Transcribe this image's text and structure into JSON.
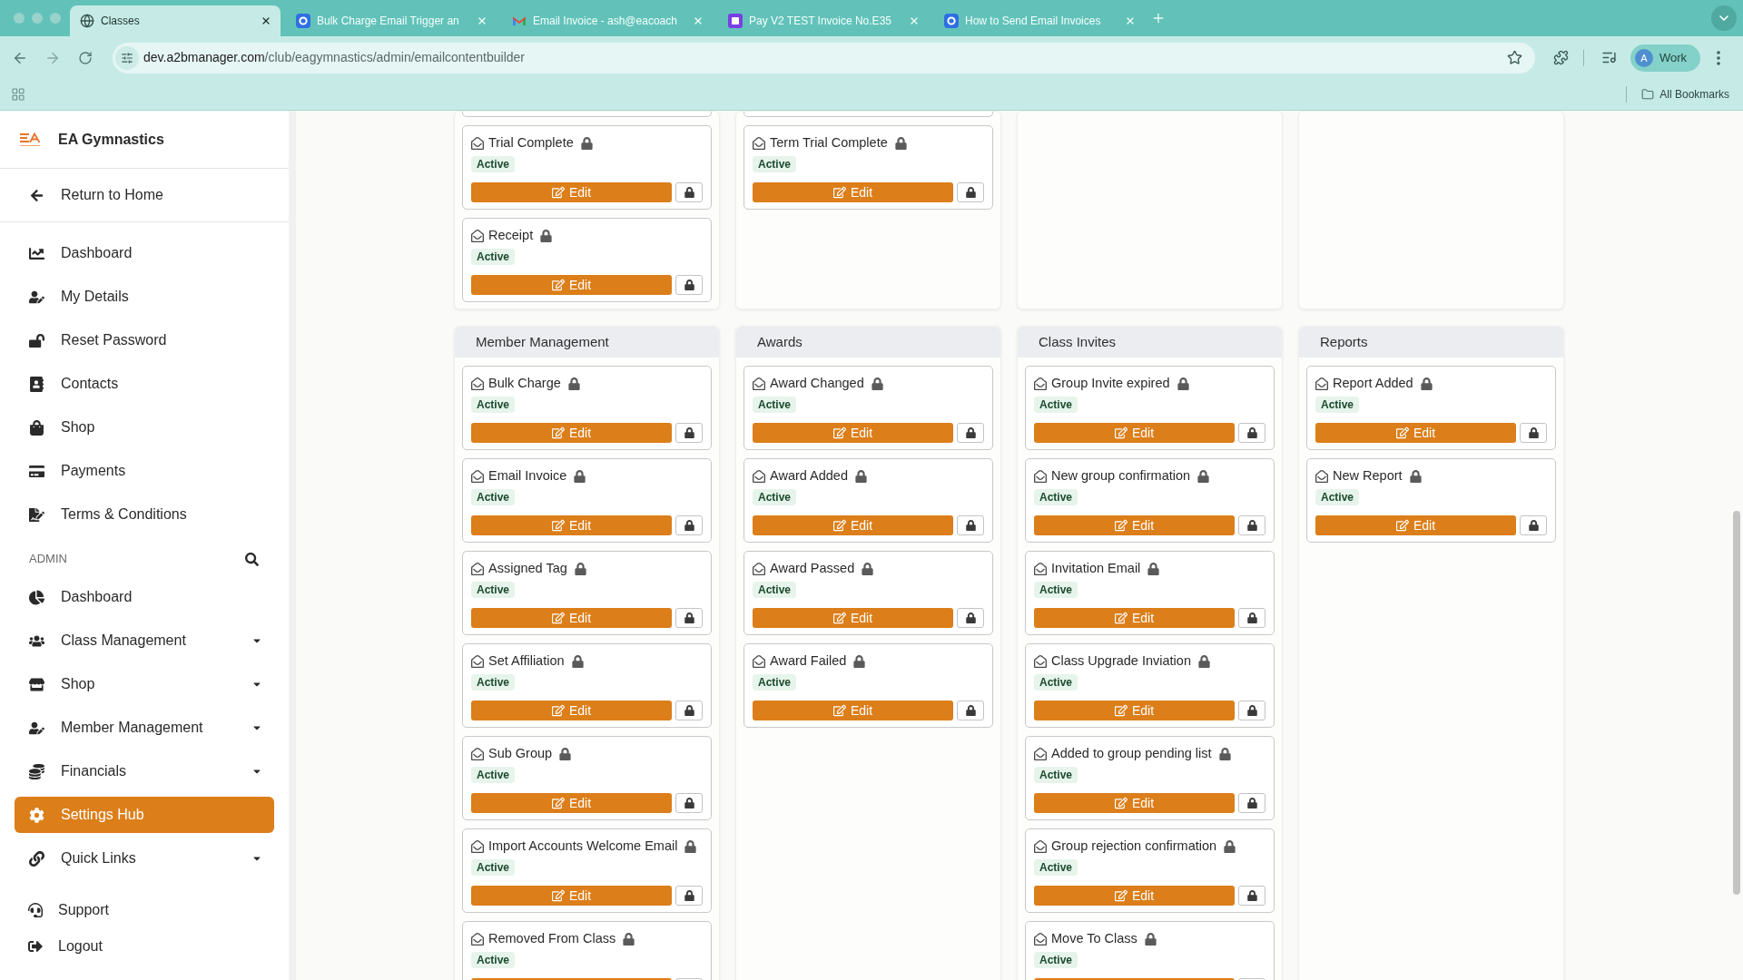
{
  "browser": {
    "tabs": [
      {
        "title": "Classes",
        "selected": true
      },
      {
        "title": "Bulk Charge Email Trigger an",
        "selected": false
      },
      {
        "title": "Email Invoice - ash@eacoach",
        "selected": false
      },
      {
        "title": "Pay V2 TEST Invoice No.E35",
        "selected": false
      },
      {
        "title": "How to Send Email Invoices",
        "selected": false
      }
    ],
    "url": {
      "host": "dev.a2bmanager.com",
      "path": "/club/eagymnastics/admin/emailcontentbuilder"
    },
    "profile": {
      "initial": "A",
      "label": "Work"
    },
    "bookmarks_label": "All Bookmarks"
  },
  "sidebar": {
    "brand": "EA Gymnastics",
    "return_link": "Return to Home",
    "items": [
      {
        "label": "Dashboard",
        "selected": false
      },
      {
        "label": "My Details",
        "selected": false
      },
      {
        "label": "Reset Password",
        "selected": false
      },
      {
        "label": "Contacts",
        "selected": false
      },
      {
        "label": "Shop",
        "selected": false
      },
      {
        "label": "Payments",
        "selected": false
      },
      {
        "label": "Terms & Conditions",
        "selected": false
      }
    ],
    "admin_heading": "ADMIN",
    "admin_items": [
      {
        "label": "Dashboard",
        "selected": false,
        "expandable": false
      },
      {
        "label": "Class Management",
        "selected": false,
        "expandable": true
      },
      {
        "label": "Shop",
        "selected": false,
        "expandable": true
      },
      {
        "label": "Member Management",
        "selected": false,
        "expandable": true
      },
      {
        "label": "Financials",
        "selected": false,
        "expandable": true
      },
      {
        "label": "Settings Hub",
        "selected": true,
        "expandable": false
      },
      {
        "label": "Quick Links",
        "selected": false,
        "expandable": true
      }
    ],
    "footer_links": [
      "Support",
      "Logout"
    ]
  },
  "panels": [
    {
      "cut_card_above": true,
      "cards": [
        {
          "title": "Trial Complete",
          "status": "Active",
          "edit_label": "Edit"
        },
        {
          "title": "Receipt",
          "status": "Active",
          "edit_label": "Edit"
        }
      ]
    },
    {
      "cut_card_above": true,
      "cards": [
        {
          "title": "Term Trial Complete",
          "status": "Active",
          "edit_label": "Edit"
        }
      ]
    },
    {
      "cut_card_above": false
    },
    {
      "cut_card_above": false
    },
    {
      "title": "Member Management",
      "cut_card_above": false,
      "cards": [
        {
          "title": "Bulk Charge",
          "status": "Active",
          "edit_label": "Edit"
        },
        {
          "title": "Email Invoice",
          "status": "Active",
          "edit_label": "Edit"
        },
        {
          "title": "Assigned Tag",
          "status": "Active",
          "edit_label": "Edit"
        },
        {
          "title": "Set Affiliation",
          "status": "Active",
          "edit_label": "Edit"
        },
        {
          "title": "Sub Group",
          "status": "Active",
          "edit_label": "Edit"
        },
        {
          "title": "Import Accounts Welcome Email",
          "status": "Active",
          "edit_label": "Edit"
        },
        {
          "title": "Removed From Class",
          "status": "Active"
        }
      ]
    },
    {
      "title": "Awards",
      "cut_card_above": false,
      "cards": [
        {
          "title": "Award Changed",
          "status": "Active",
          "edit_label": "Edit"
        },
        {
          "title": "Award Added",
          "status": "Active",
          "edit_label": "Edit"
        },
        {
          "title": "Award Passed",
          "status": "Active",
          "edit_label": "Edit"
        },
        {
          "title": "Award Failed",
          "status": "Active",
          "edit_label": "Edit"
        }
      ]
    },
    {
      "title": "Class Invites",
      "cut_card_above": false,
      "cards": [
        {
          "title": "Group Invite expired",
          "status": "Active",
          "edit_label": "Edit"
        },
        {
          "title": "New group confirmation",
          "status": "Active",
          "edit_label": "Edit"
        },
        {
          "title": "Invitation Email",
          "status": "Active",
          "edit_label": "Edit"
        },
        {
          "title": "Class Upgrade Inviation",
          "status": "Active",
          "edit_label": "Edit"
        },
        {
          "title": "Added to group pending list",
          "status": "Active",
          "edit_label": "Edit"
        },
        {
          "title": "Group rejection confirmation",
          "status": "Active",
          "edit_label": "Edit"
        },
        {
          "title": "Move To Class",
          "status": "Active"
        }
      ]
    },
    {
      "title": "Reports",
      "cut_card_above": false,
      "cards": [
        {
          "title": "Report Added",
          "status": "Active",
          "edit_label": "Edit"
        },
        {
          "title": "New Report",
          "status": "Active",
          "edit_label": "Edit"
        }
      ]
    }
  ]
}
